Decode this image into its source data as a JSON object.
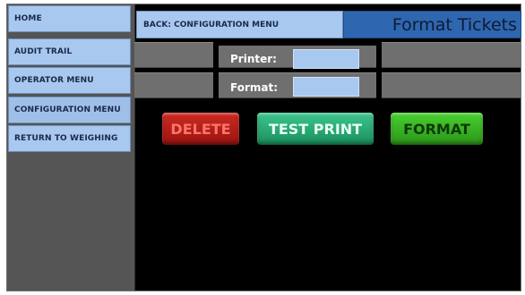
{
  "sidebar": {
    "items": [
      {
        "label": "HOME"
      },
      {
        "label": "AUDIT TRAIL"
      },
      {
        "label": "OPERATOR MENU"
      },
      {
        "label": "CONFIGURATION MENU"
      },
      {
        "label": "RETURN TO WEIGHING"
      }
    ]
  },
  "header": {
    "back_label": "BACK: CONFIGURATION MENU",
    "title": "Format Tickets"
  },
  "fields": {
    "printer_label": "Printer:",
    "printer_value": "",
    "format_label": "Format:",
    "format_value": ""
  },
  "actions": {
    "delete_label": "DELETE",
    "test_print_label": "TEST PRINT",
    "format_label": "FORMAT"
  },
  "colors": {
    "nav_button": "#a8c8f0",
    "title_bar": "#2f66b0",
    "delete": "#b01c17",
    "test_print": "#28a874",
    "format": "#3ab324"
  }
}
